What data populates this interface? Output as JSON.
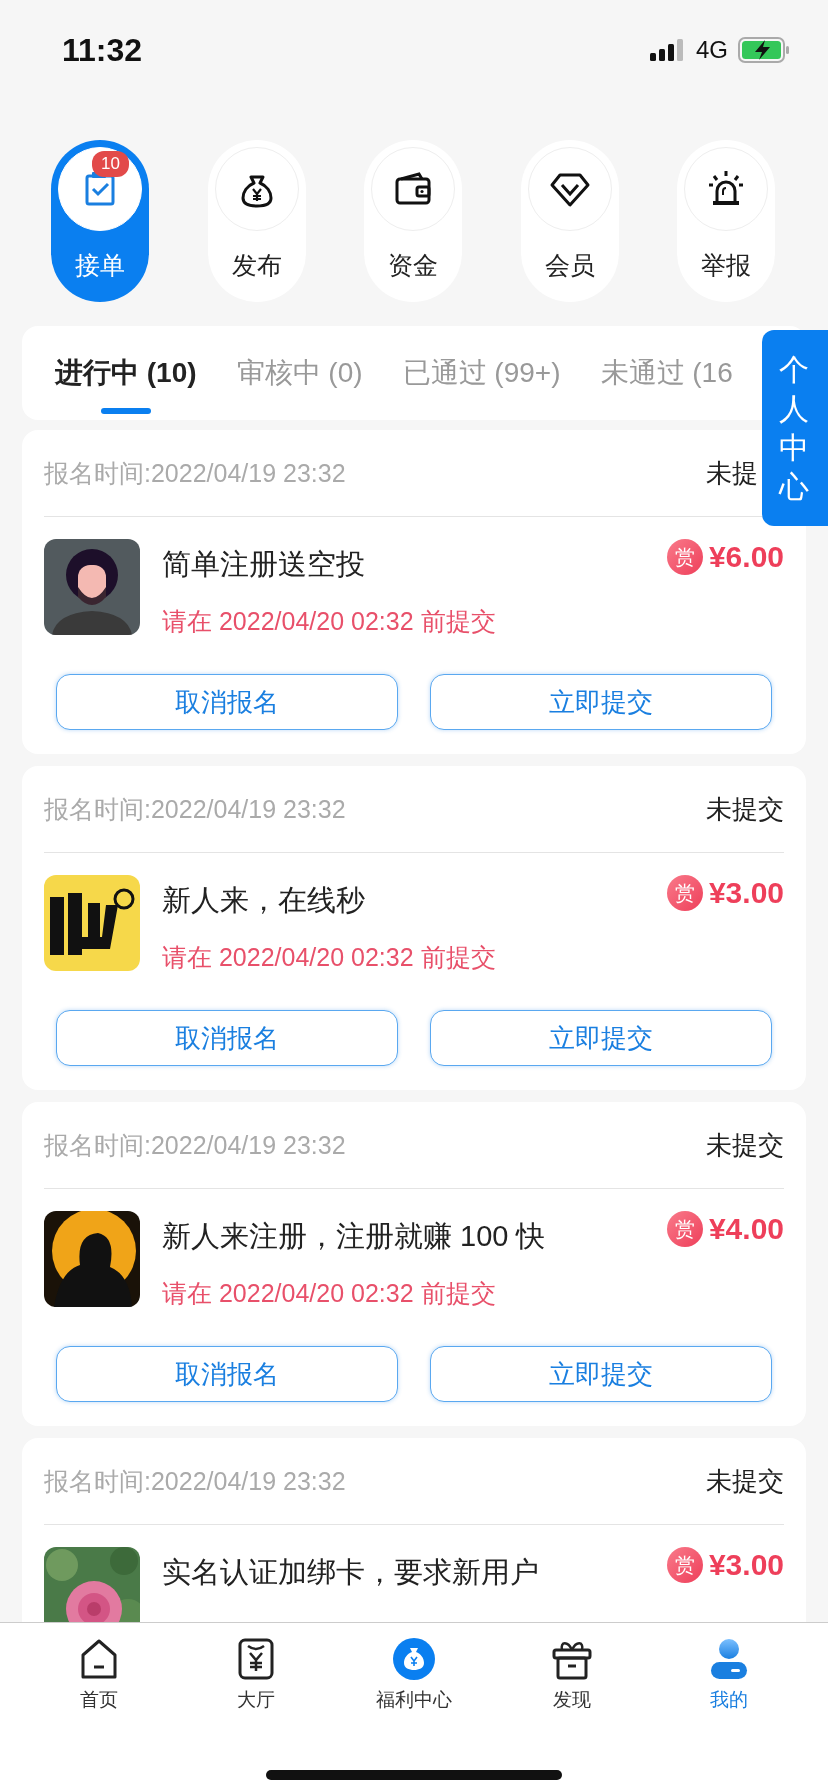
{
  "status_bar": {
    "time": "11:32",
    "network": "4G"
  },
  "shortcuts": [
    {
      "label": "接单",
      "selected": true,
      "badge": "10"
    },
    {
      "label": "发布",
      "selected": false
    },
    {
      "label": "资金",
      "selected": false
    },
    {
      "label": "会员",
      "selected": false
    },
    {
      "label": "举报",
      "selected": false
    }
  ],
  "tabs": [
    {
      "label": "进行中 (10)",
      "selected": true
    },
    {
      "label": "审核中 (0)",
      "selected": false
    },
    {
      "label": "已通过 (99+)",
      "selected": false
    },
    {
      "label": "未通过 (16",
      "selected": false
    }
  ],
  "side_button": {
    "label": "个人中心"
  },
  "orders": [
    {
      "signup_time": "报名时间:2022/04/19 23:32",
      "status": "未提",
      "title": "简单注册送空投",
      "reward_badge": "赏",
      "reward": "¥6.00",
      "deadline": "请在 2022/04/20 02:32 前提交",
      "buttons": [
        "取消报名",
        "立即提交"
      ]
    },
    {
      "signup_time": "报名时间:2022/04/19 23:32",
      "status": "未提交",
      "title": "新人来，在线秒",
      "reward_badge": "赏",
      "reward": "¥3.00",
      "deadline": "请在 2022/04/20 02:32 前提交",
      "buttons": [
        "取消报名",
        "立即提交"
      ]
    },
    {
      "signup_time": "报名时间:2022/04/19 23:32",
      "status": "未提交",
      "title": "新人来注册，注册就赚 100 快",
      "reward_badge": "赏",
      "reward": "¥4.00",
      "deadline": "请在 2022/04/20 02:32 前提交",
      "buttons": [
        "取消报名",
        "立即提交"
      ]
    },
    {
      "signup_time": "报名时间:2022/04/19 23:32",
      "status": "未提交",
      "title": "实名认证加绑卡，要求新用户",
      "reward_badge": "赏",
      "reward": "¥3.00"
    }
  ],
  "bottom_nav": [
    {
      "label": "首页",
      "selected": false
    },
    {
      "label": "大厅",
      "selected": false
    },
    {
      "label": "福利中心",
      "selected": false
    },
    {
      "label": "发现",
      "selected": false
    },
    {
      "label": "我的",
      "selected": true
    }
  ]
}
